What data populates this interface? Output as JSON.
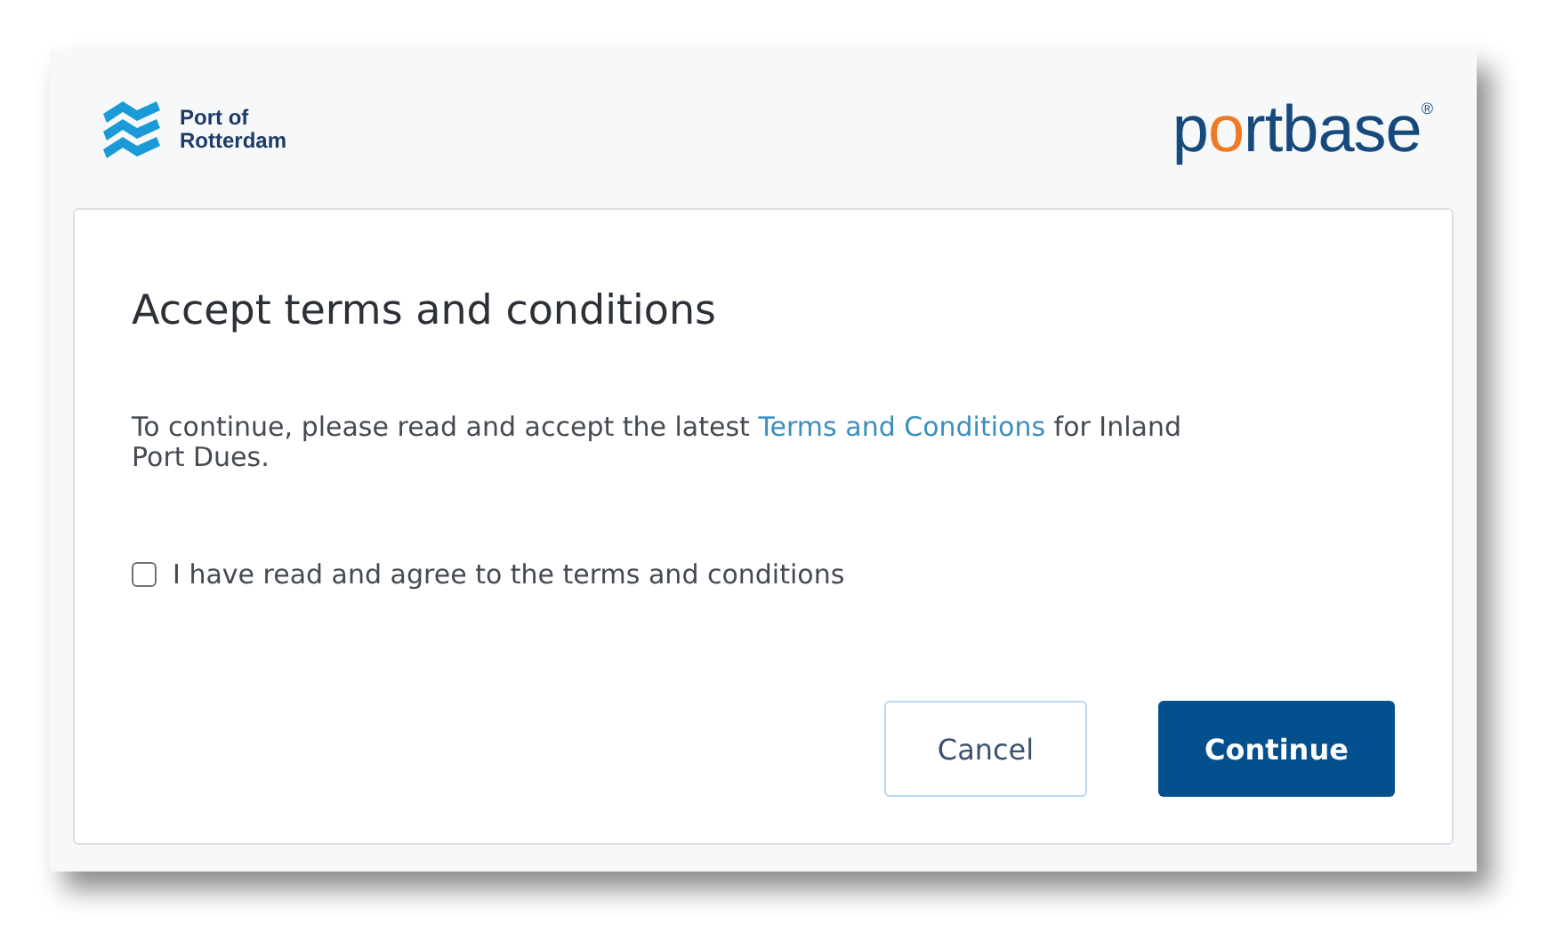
{
  "header": {
    "left_logo": {
      "line_1": "Port of",
      "line_2": "Rotterdam"
    },
    "right_logo": {
      "text": "portbase",
      "mark": "®"
    }
  },
  "dialog": {
    "title": "Accept terms and conditions",
    "message_before": "To continue, please read and accept the latest ",
    "link": "Terms and Conditions",
    "message_after": " for Inland Port Dues.",
    "checkbox": {
      "label": "I have read and agree to the terms and conditions",
      "checked": false
    },
    "buttons": [
      {
        "label": "Cancel",
        "kind": "secondary"
      },
      {
        "label": "Continue",
        "kind": "primary"
      }
    ]
  }
}
